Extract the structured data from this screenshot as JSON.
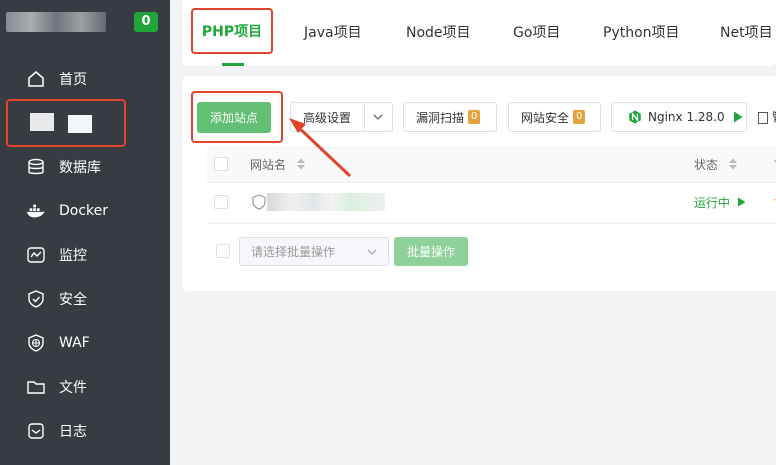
{
  "sidebar": {
    "badge": "0",
    "items": [
      {
        "label": "首页",
        "icon": "home-icon"
      },
      {
        "label": "数据库",
        "icon": "database-icon"
      },
      {
        "label": "Docker",
        "icon": "docker-icon"
      },
      {
        "label": "监控",
        "icon": "monitor-icon"
      },
      {
        "label": "安全",
        "icon": "shield-icon"
      },
      {
        "label": "WAF",
        "icon": "waf-globe-icon"
      },
      {
        "label": "文件",
        "icon": "folder-icon"
      },
      {
        "label": "日志",
        "icon": "log-icon"
      }
    ]
  },
  "tabs": [
    {
      "label": "PHP项目"
    },
    {
      "label": "Java项目"
    },
    {
      "label": "Node项目"
    },
    {
      "label": "Go项目"
    },
    {
      "label": "Python项目"
    },
    {
      "label": "Net项目"
    }
  ],
  "toolbar": {
    "add_site": "添加站点",
    "advanced": "高级设置",
    "vuln_scan": "漏洞扫描",
    "vuln_count": "0",
    "site_security": "网站安全",
    "security_count": "0",
    "nginx": "Nginx 1.28.0",
    "truncated": "管"
  },
  "table": {
    "col_site": "网站名",
    "col_status": "状态",
    "rows": [
      {
        "status": "运行中"
      }
    ]
  },
  "batch": {
    "placeholder": "请选择批量操作",
    "button": "批量操作"
  },
  "colors": {
    "brand_green": "#20a53a",
    "highlight_red": "#e0442b",
    "sidebar_bg": "#363c42"
  }
}
